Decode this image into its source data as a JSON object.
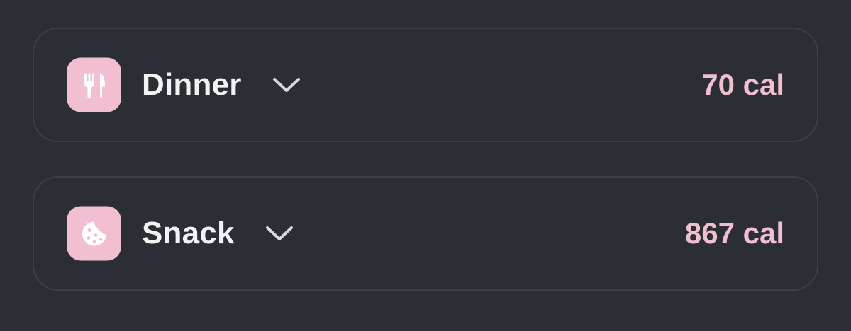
{
  "colors": {
    "background": "#2b2e35",
    "card_border": "#3c3f47",
    "accent_pink": "#f2bfd2",
    "text_primary": "#f3f3f5",
    "chevron": "#d8d9de"
  },
  "meals": [
    {
      "name": "Dinner",
      "calories": "70 cal",
      "icon": "fork-knife-icon",
      "expand_icon": "chevron-down-icon"
    },
    {
      "name": "Snack",
      "calories": "867 cal",
      "icon": "cookie-icon",
      "expand_icon": "chevron-down-icon"
    }
  ]
}
